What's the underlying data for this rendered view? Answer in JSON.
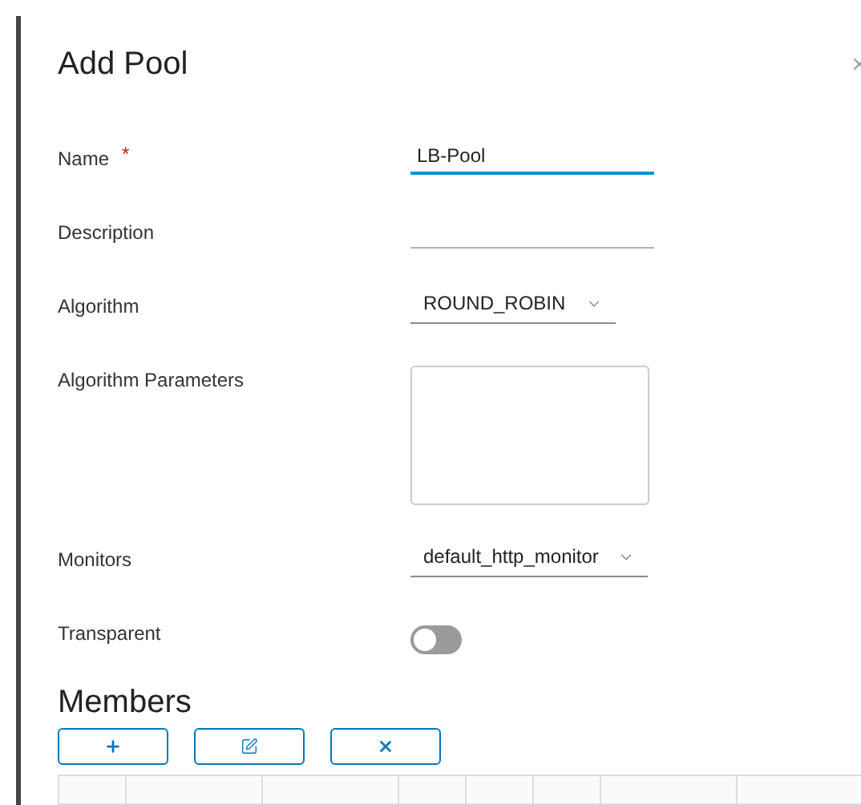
{
  "dialog": {
    "title": "Add Pool"
  },
  "fields": [
    {
      "kind": "text",
      "label": "Name",
      "required_mark": "*",
      "value": "LB-Pool",
      "focused": true
    },
    {
      "kind": "text",
      "label": "Description",
      "focused": false
    },
    {
      "kind": "select",
      "label": "Algorithm",
      "value": "ROUND_ROBIN"
    },
    {
      "kind": "textarea",
      "label": "Algorithm Parameters"
    },
    {
      "kind": "select",
      "label": "Monitors",
      "value": "default_http_monitor"
    },
    {
      "kind": "toggle",
      "label": "Transparent",
      "on": false
    }
  ],
  "members": {
    "title": "Members",
    "buttons": [
      {
        "kind": "add"
      },
      {
        "kind": "edit"
      },
      {
        "kind": "delete"
      }
    ]
  }
}
